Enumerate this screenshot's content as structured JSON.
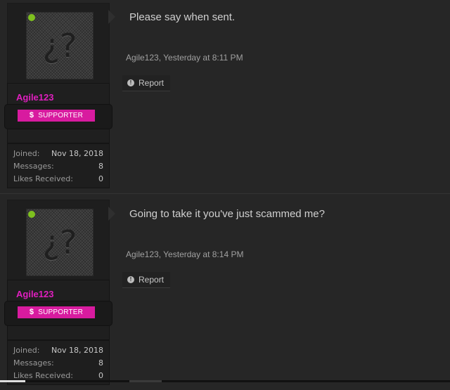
{
  "posts": [
    {
      "username": "Agile123",
      "badge_label": "SUPPORTER",
      "badge_symbol": "$",
      "avatar_glyph": "¿?",
      "online_icon": "online-dot-icon",
      "stats": [
        {
          "label": "Joined:",
          "value": "Nov 18, 2018"
        },
        {
          "label": "Messages:",
          "value": "8"
        },
        {
          "label": "Likes Received:",
          "value": "0"
        }
      ],
      "message": "Please say when sent.",
      "meta": "Agile123, Yesterday at 8:11 PM",
      "report_label": "Report"
    },
    {
      "username": "Agile123",
      "badge_label": "SUPPORTER",
      "badge_symbol": "$",
      "avatar_glyph": "¿?",
      "online_icon": "online-dot-icon",
      "stats": [
        {
          "label": "Joined:",
          "value": "Nov 18, 2018"
        },
        {
          "label": "Messages:",
          "value": "8"
        },
        {
          "label": "Likes Received:",
          "value": "0"
        }
      ],
      "message": "Going to take it you've just scammed me?",
      "meta": "Agile123, Yesterday at 8:14 PM",
      "report_label": "Report"
    }
  ],
  "colors": {
    "background": "#262626",
    "username": "#e01fbf",
    "badge": "#d81b9f",
    "online": "#7ec01e"
  }
}
